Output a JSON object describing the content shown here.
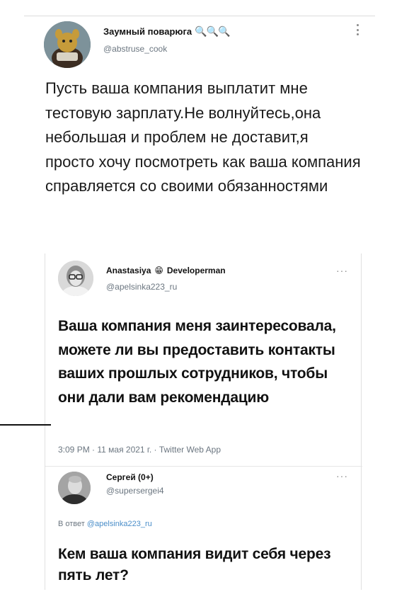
{
  "tweet": {
    "display_name": "Заумный поварюга",
    "name_emoji": "🔍🔍🔍",
    "handle": "@abstruse_cook",
    "text": "Пусть ваша компания выплатит мне тестовую зарплату.Не волнуйтесь,она небольшая и проблем не доставит,я просто хочу посмотреть как ваша компания справляется со своими обязанностями"
  },
  "quoted": {
    "display_name": "Anastasiya",
    "name_emoji": "😁",
    "name_suffix": "Developerman",
    "handle": "@apelsinka223_ru",
    "more": "···",
    "text": "Ваша компания меня заинтересовала, можете ли вы предоставить контакты ваших прошлых сотрудников, чтобы они дали вам рекомендацию",
    "meta": "3:09 PM · 11 мая 2021 г. · Twitter Web App"
  },
  "reply": {
    "display_name": "Сергей (0+)",
    "handle": "@supersergei4",
    "more": "···",
    "reply_prefix": "В ответ",
    "reply_to": "@apelsinka223_ru",
    "text": "Кем ваша компания видит себя через пять лет?"
  },
  "icons": {
    "menu": "vertical-dots-icon",
    "more": "horizontal-dots-icon"
  }
}
